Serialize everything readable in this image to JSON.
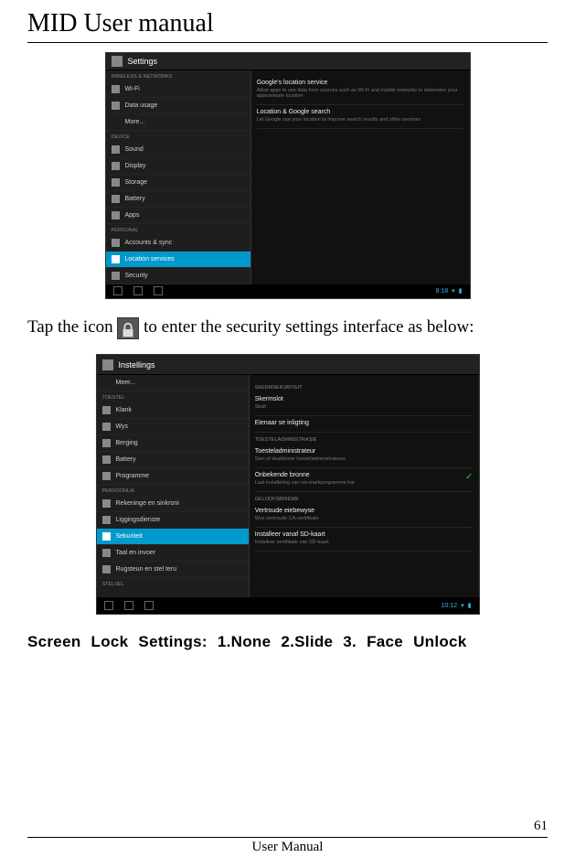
{
  "doc": {
    "title": "MID User manual",
    "footer_text": "User Manual",
    "page_number": "61"
  },
  "para1_a": "Tap the icon ",
  "para1_b": " to enter the security settings interface as below:",
  "screen_lock_text": "Screen Lock Settings: 1.None 2.Slide 3. Face Unlock",
  "shot1": {
    "title": "Settings",
    "sec_wireless": "WIRELESS & NETWORKS",
    "sec_device": "DEVICE",
    "sec_personal": "PERSONAL",
    "items": {
      "wifi": "Wi-Fi",
      "data": "Data usage",
      "more": "More...",
      "sound": "Sound",
      "display": "Display",
      "storage": "Storage",
      "battery": "Battery",
      "apps": "Apps",
      "accounts": "Accounts & sync",
      "location": "Location services",
      "security": "Security"
    },
    "right": {
      "t1": "Google's location service",
      "s1": "Allow apps to use data from sources such as Wi-Fi and mobile networks to determine your approximate location",
      "t2": "Location & Google search",
      "s2": "Let Google use your location to improve search results and other services"
    },
    "clock": "8:18"
  },
  "shot2": {
    "title": "Instellings",
    "sec_device": "TOESTEL",
    "sec_personal": "PERSOONLIK",
    "sec_system": "STELSEL",
    "items": {
      "more": "Meer...",
      "sound": "Klank",
      "display": "Wys",
      "storage": "Berging",
      "battery": "Battery",
      "apps": "Programme",
      "accounts": "Rekeninge en sinkroni",
      "location": "Liggingsdienste",
      "security": "Sekuriteit",
      "language": "Taal en invoer",
      "backup": "Rugsteun en stel teru"
    },
    "right": {
      "sec1": "SKERMSEKURITEIT",
      "t1": "Skermslot",
      "s1": "Skuif",
      "t2": "Eienaar se inligting",
      "sec2": "TOESTELADMINISTRASIE",
      "t3": "Toesteladministrateur",
      "s3": "Sien of deaktiveer toesteladministrateurs",
      "t4": "Onbekende bronne",
      "s4": "Laat installering van nie-markprogramme toe",
      "sec3": "GELOOFSBRIEWE",
      "t5": "Vertroude eiebewyse",
      "s5": "Wys vertroude CA-sertifikate",
      "t6": "Installeer vanaf SD-kaart",
      "s6": "Installeer sertifikate van SD-kaart"
    },
    "clock": "10:12"
  }
}
